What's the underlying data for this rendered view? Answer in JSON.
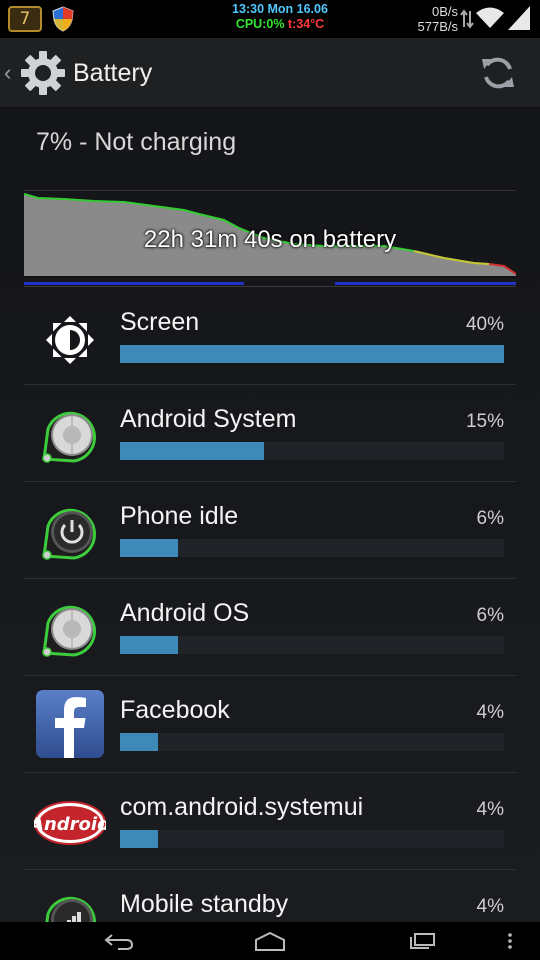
{
  "status_bar": {
    "notification_count": "7",
    "time_line": "13:30 Mon 16.06",
    "cpu": "CPU:0%",
    "temp": "t:34°C",
    "net_up": "0B/s",
    "net_down": "577B/s"
  },
  "action_bar": {
    "title": "Battery",
    "icon": "settings-gear-icon",
    "refresh_icon": "refresh-icon"
  },
  "battery": {
    "status": "7% - Not charging",
    "graph_label": "22h 31m 40s on battery"
  },
  "usage_items": [
    {
      "label": "Screen",
      "percent": "40%",
      "fraction": 0.4,
      "icon": "brightness-icon"
    },
    {
      "label": "Android System",
      "percent": "15%",
      "fraction": 0.15,
      "icon": "android-system-icon"
    },
    {
      "label": "Phone idle",
      "percent": "6%",
      "fraction": 0.06,
      "icon": "power-icon"
    },
    {
      "label": "Android OS",
      "percent": "6%",
      "fraction": 0.06,
      "icon": "android-os-icon"
    },
    {
      "label": "Facebook",
      "percent": "4%",
      "fraction": 0.04,
      "icon": "facebook-icon"
    },
    {
      "label": "com.android.systemui",
      "percent": "4%",
      "fraction": 0.04,
      "icon": "android-logo-icon"
    },
    {
      "label": "Mobile standby",
      "percent": "4%",
      "fraction": 0.04,
      "icon": "signal-icon"
    }
  ],
  "colors": {
    "bar_fill": "#3d8ab9",
    "graph_line": "#33cc33",
    "graph_area": "#8a8a8a"
  }
}
